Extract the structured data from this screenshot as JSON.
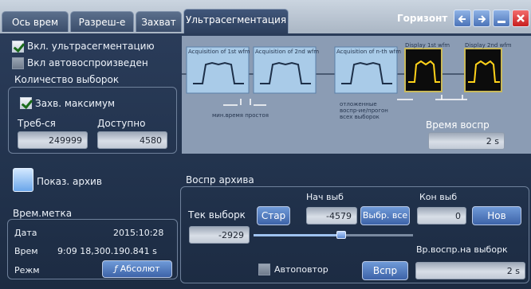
{
  "tabs": [
    {
      "label": "Ось врем"
    },
    {
      "label": "Разреш-е"
    },
    {
      "label": "Захват"
    },
    {
      "label": "Ультрасегментация",
      "active": true
    }
  ],
  "header": {
    "title": "Горизонт",
    "buttons": [
      "back-icon",
      "forward-icon",
      "minimize-icon",
      "close-icon"
    ]
  },
  "left": {
    "enable_ultraseg": "Вкл. ультрасегментацию",
    "enable_autoplay": "Вкл автовоспроизведен",
    "sample_count_title": "Количество выборок",
    "capture_max": "Захв. максимум",
    "required_label": "Треб-ся",
    "available_label": "Доступно",
    "required_value": "249999",
    "available_value": "4580"
  },
  "diagram": {
    "captions": [
      "Acquisition of 1st wfm",
      "Acquisition of 2nd wfm",
      "Acquisition of n-th wfm",
      "Display 1st wfm",
      "Display 2nd wfm"
    ],
    "dead_time": "мин.время простоя",
    "history_note": [
      "отложенные",
      "воспр-ие/прогон",
      "всех выборок"
    ],
    "playback_time_label": "Время воспр",
    "playback_time_value": "2 s"
  },
  "archive": {
    "show_label": "Показ. архив",
    "timestamp_title": "Врем.метка",
    "date_label": "Дата",
    "date_value": "2015:10:28",
    "time_label": "Врем",
    "time_value": "9:09 18,300.190.841 s",
    "mode_label": "Режм",
    "mode_value": "Абсолют"
  },
  "playback": {
    "title": "Воспр архива",
    "start_label": "Нач выб",
    "end_label": "Кон выб",
    "current_label": "Тек выборк",
    "current_value": "-2929",
    "start_btn": "Стар",
    "start_value": "-4579",
    "select_all": "Выбр. все",
    "end_value": "0",
    "new_btn": "Нов",
    "autorepeat": "Автоповтор",
    "play_btn": "Вспр",
    "per_sample_label": "Вр.воспр.на выборк",
    "per_sample_value": "2 s",
    "slider_position": 0.55
  }
}
